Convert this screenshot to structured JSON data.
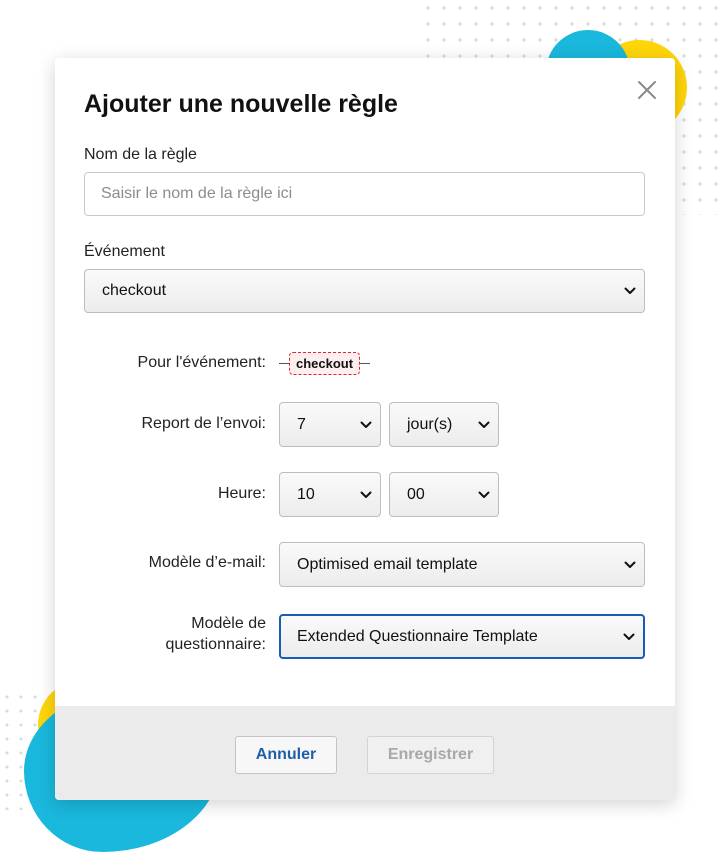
{
  "dialog": {
    "title": "Ajouter une nouvelle règle",
    "close_icon": "close-icon"
  },
  "rule_name": {
    "label": "Nom de la règle",
    "placeholder": "Saisir le nom de la règle ici",
    "value": ""
  },
  "event": {
    "label": "Événement",
    "selected": "checkout"
  },
  "for_event": {
    "label": "Pour l'événement:",
    "tag": "checkout"
  },
  "delay": {
    "label": "Report de l’envoi:",
    "amount": "7",
    "unit": "jour(s)"
  },
  "time": {
    "label": "Heure:",
    "hour": "10",
    "minute": "00"
  },
  "email_template": {
    "label": "Modèle d’e-mail:",
    "selected": "Optimised email template"
  },
  "questionnaire_template": {
    "label_line1": "Modèle de",
    "label_line2": "questionnaire:",
    "selected": "Extended Questionnaire Template"
  },
  "footer": {
    "cancel_label": "Annuler",
    "save_label": "Enregistrer"
  },
  "colors": {
    "accent_blue": "#1a5bb5",
    "brand_cyan": "#1ab8dc",
    "brand_yellow": "#ffd50a",
    "tag_red": "#e4242e"
  }
}
